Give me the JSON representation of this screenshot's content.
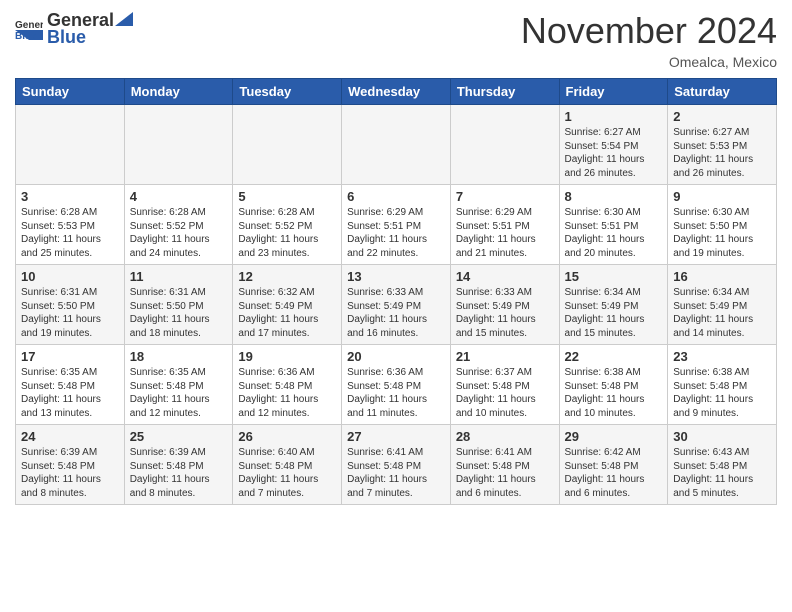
{
  "header": {
    "logo_general": "General",
    "logo_blue": "Blue",
    "month_title": "November 2024",
    "location": "Omealca, Mexico"
  },
  "days_of_week": [
    "Sunday",
    "Monday",
    "Tuesday",
    "Wednesday",
    "Thursday",
    "Friday",
    "Saturday"
  ],
  "weeks": [
    [
      {
        "day": "",
        "info": ""
      },
      {
        "day": "",
        "info": ""
      },
      {
        "day": "",
        "info": ""
      },
      {
        "day": "",
        "info": ""
      },
      {
        "day": "",
        "info": ""
      },
      {
        "day": "1",
        "info": "Sunrise: 6:27 AM\nSunset: 5:54 PM\nDaylight: 11 hours and 26 minutes."
      },
      {
        "day": "2",
        "info": "Sunrise: 6:27 AM\nSunset: 5:53 PM\nDaylight: 11 hours and 26 minutes."
      }
    ],
    [
      {
        "day": "3",
        "info": "Sunrise: 6:28 AM\nSunset: 5:53 PM\nDaylight: 11 hours and 25 minutes."
      },
      {
        "day": "4",
        "info": "Sunrise: 6:28 AM\nSunset: 5:52 PM\nDaylight: 11 hours and 24 minutes."
      },
      {
        "day": "5",
        "info": "Sunrise: 6:28 AM\nSunset: 5:52 PM\nDaylight: 11 hours and 23 minutes."
      },
      {
        "day": "6",
        "info": "Sunrise: 6:29 AM\nSunset: 5:51 PM\nDaylight: 11 hours and 22 minutes."
      },
      {
        "day": "7",
        "info": "Sunrise: 6:29 AM\nSunset: 5:51 PM\nDaylight: 11 hours and 21 minutes."
      },
      {
        "day": "8",
        "info": "Sunrise: 6:30 AM\nSunset: 5:51 PM\nDaylight: 11 hours and 20 minutes."
      },
      {
        "day": "9",
        "info": "Sunrise: 6:30 AM\nSunset: 5:50 PM\nDaylight: 11 hours and 19 minutes."
      }
    ],
    [
      {
        "day": "10",
        "info": "Sunrise: 6:31 AM\nSunset: 5:50 PM\nDaylight: 11 hours and 19 minutes."
      },
      {
        "day": "11",
        "info": "Sunrise: 6:31 AM\nSunset: 5:50 PM\nDaylight: 11 hours and 18 minutes."
      },
      {
        "day": "12",
        "info": "Sunrise: 6:32 AM\nSunset: 5:49 PM\nDaylight: 11 hours and 17 minutes."
      },
      {
        "day": "13",
        "info": "Sunrise: 6:33 AM\nSunset: 5:49 PM\nDaylight: 11 hours and 16 minutes."
      },
      {
        "day": "14",
        "info": "Sunrise: 6:33 AM\nSunset: 5:49 PM\nDaylight: 11 hours and 15 minutes."
      },
      {
        "day": "15",
        "info": "Sunrise: 6:34 AM\nSunset: 5:49 PM\nDaylight: 11 hours and 15 minutes."
      },
      {
        "day": "16",
        "info": "Sunrise: 6:34 AM\nSunset: 5:49 PM\nDaylight: 11 hours and 14 minutes."
      }
    ],
    [
      {
        "day": "17",
        "info": "Sunrise: 6:35 AM\nSunset: 5:48 PM\nDaylight: 11 hours and 13 minutes."
      },
      {
        "day": "18",
        "info": "Sunrise: 6:35 AM\nSunset: 5:48 PM\nDaylight: 11 hours and 12 minutes."
      },
      {
        "day": "19",
        "info": "Sunrise: 6:36 AM\nSunset: 5:48 PM\nDaylight: 11 hours and 12 minutes."
      },
      {
        "day": "20",
        "info": "Sunrise: 6:36 AM\nSunset: 5:48 PM\nDaylight: 11 hours and 11 minutes."
      },
      {
        "day": "21",
        "info": "Sunrise: 6:37 AM\nSunset: 5:48 PM\nDaylight: 11 hours and 10 minutes."
      },
      {
        "day": "22",
        "info": "Sunrise: 6:38 AM\nSunset: 5:48 PM\nDaylight: 11 hours and 10 minutes."
      },
      {
        "day": "23",
        "info": "Sunrise: 6:38 AM\nSunset: 5:48 PM\nDaylight: 11 hours and 9 minutes."
      }
    ],
    [
      {
        "day": "24",
        "info": "Sunrise: 6:39 AM\nSunset: 5:48 PM\nDaylight: 11 hours and 8 minutes."
      },
      {
        "day": "25",
        "info": "Sunrise: 6:39 AM\nSunset: 5:48 PM\nDaylight: 11 hours and 8 minutes."
      },
      {
        "day": "26",
        "info": "Sunrise: 6:40 AM\nSunset: 5:48 PM\nDaylight: 11 hours and 7 minutes."
      },
      {
        "day": "27",
        "info": "Sunrise: 6:41 AM\nSunset: 5:48 PM\nDaylight: 11 hours and 7 minutes."
      },
      {
        "day": "28",
        "info": "Sunrise: 6:41 AM\nSunset: 5:48 PM\nDaylight: 11 hours and 6 minutes."
      },
      {
        "day": "29",
        "info": "Sunrise: 6:42 AM\nSunset: 5:48 PM\nDaylight: 11 hours and 6 minutes."
      },
      {
        "day": "30",
        "info": "Sunrise: 6:43 AM\nSunset: 5:48 PM\nDaylight: 11 hours and 5 minutes."
      }
    ]
  ]
}
